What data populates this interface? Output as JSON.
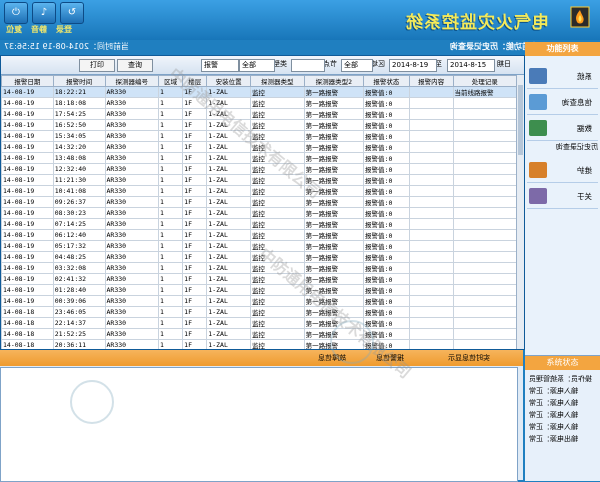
{
  "app": {
    "title": "电气火灾监控系统",
    "subtitle": "当前功能：历史记录查询",
    "status": "当前时间：2014-08-19 15:56:37"
  },
  "window_buttons": [
    {
      "label": "登录",
      "icon": "login-icon"
    },
    {
      "label": "静音",
      "icon": "mute-icon"
    },
    {
      "label": "复位",
      "icon": "reset-icon"
    }
  ],
  "toolbar": {
    "start_label": "日期",
    "start_value": "2014-8-15",
    "to_label": "至",
    "end_value": "2014-8-19",
    "area_label": "区域",
    "area_value": "全部",
    "node_label": "节点",
    "type_label": "类型",
    "type_value": "全部",
    "alarm_value": "报警",
    "query_label": "查询",
    "print_label": "打印"
  },
  "table": {
    "headers": [
      "报警日期",
      "报警时间",
      "探测器编号",
      "区域",
      "楼层",
      "安装位置",
      "探测器类型",
      "探测器类型2",
      "报警状态",
      "报警内容",
      "处理记录"
    ],
    "rows": [
      [
        "14-08-19",
        "18:22:21",
        "AR330",
        "1",
        "1F",
        "1-ZAL",
        "监控",
        "第一路报警",
        "报警值:0",
        "",
        "当前线路报警"
      ],
      [
        "14-08-19",
        "18:18:08",
        "AR330",
        "1",
        "1F",
        "1-ZAL",
        "监控",
        "第一路报警",
        "报警值:0",
        "",
        ""
      ],
      [
        "14-08-19",
        "17:54:25",
        "AR330",
        "1",
        "1F",
        "1-ZAL",
        "监控",
        "第一路报警",
        "报警值:0",
        "",
        ""
      ],
      [
        "14-08-19",
        "16:52:50",
        "AR330",
        "1",
        "1F",
        "1-ZAL",
        "监控",
        "第一路报警",
        "报警值:0",
        "",
        ""
      ],
      [
        "14-08-19",
        "15:34:05",
        "AR330",
        "1",
        "1F",
        "1-ZAL",
        "监控",
        "第一路报警",
        "报警值:0",
        "",
        ""
      ],
      [
        "14-08-19",
        "14:32:20",
        "AR330",
        "1",
        "1F",
        "1-ZAL",
        "监控",
        "第一路报警",
        "报警值:0",
        "",
        ""
      ],
      [
        "14-08-19",
        "13:48:08",
        "AR330",
        "1",
        "1F",
        "1-ZAL",
        "监控",
        "第一路报警",
        "报警值:0",
        "",
        ""
      ],
      [
        "14-08-19",
        "12:32:40",
        "AR330",
        "1",
        "1F",
        "1-ZAL",
        "监控",
        "第一路报警",
        "报警值:0",
        "",
        ""
      ],
      [
        "14-08-19",
        "11:21:30",
        "AR330",
        "1",
        "1F",
        "1-ZAL",
        "监控",
        "第一路报警",
        "报警值:0",
        "",
        ""
      ],
      [
        "14-08-19",
        "10:41:08",
        "AR330",
        "1",
        "1F",
        "1-ZAL",
        "监控",
        "第一路报警",
        "报警值:0",
        "",
        ""
      ],
      [
        "14-08-19",
        "09:26:37",
        "AR330",
        "1",
        "1F",
        "1-ZAL",
        "监控",
        "第一路报警",
        "报警值:0",
        "",
        ""
      ],
      [
        "14-08-19",
        "08:30:23",
        "AR330",
        "1",
        "1F",
        "1-ZAL",
        "监控",
        "第一路报警",
        "报警值:0",
        "",
        ""
      ],
      [
        "14-08-19",
        "07:14:25",
        "AR330",
        "1",
        "1F",
        "1-ZAL",
        "监控",
        "第一路报警",
        "报警值:0",
        "",
        ""
      ],
      [
        "14-08-19",
        "06:12:40",
        "AR330",
        "1",
        "1F",
        "1-ZAL",
        "监控",
        "第一路报警",
        "报警值:0",
        "",
        ""
      ],
      [
        "14-08-19",
        "05:17:32",
        "AR330",
        "1",
        "1F",
        "1-ZAL",
        "监控",
        "第一路报警",
        "报警值:0",
        "",
        ""
      ],
      [
        "14-08-19",
        "04:48:25",
        "AR330",
        "1",
        "1F",
        "1-ZAL",
        "监控",
        "第一路报警",
        "报警值:0",
        "",
        ""
      ],
      [
        "14-08-19",
        "03:32:08",
        "AR330",
        "1",
        "1F",
        "1-ZAL",
        "监控",
        "第一路报警",
        "报警值:0",
        "",
        ""
      ],
      [
        "14-08-19",
        "02:41:32",
        "AR330",
        "1",
        "1F",
        "1-ZAL",
        "监控",
        "第一路报警",
        "报警值:0",
        "",
        ""
      ],
      [
        "14-08-19",
        "01:28:40",
        "AR330",
        "1",
        "1F",
        "1-ZAL",
        "监控",
        "第一路报警",
        "报警值:0",
        "",
        ""
      ],
      [
        "14-08-19",
        "00:39:06",
        "AR330",
        "1",
        "1F",
        "1-ZAL",
        "监控",
        "第一路报警",
        "报警值:0",
        "",
        ""
      ],
      [
        "14-08-18",
        "23:46:05",
        "AR330",
        "1",
        "1F",
        "1-ZAL",
        "监控",
        "第一路报警",
        "报警值:0",
        "",
        ""
      ],
      [
        "14-08-18",
        "22:14:37",
        "AR330",
        "1",
        "1F",
        "1-ZAL",
        "监控",
        "第一路报警",
        "报警值:0",
        "",
        ""
      ],
      [
        "14-08-18",
        "21:52:25",
        "AR330",
        "1",
        "1F",
        "1-ZAL",
        "监控",
        "第一路报警",
        "报警值:0",
        "",
        ""
      ],
      [
        "14-08-18",
        "20:36:11",
        "AR330",
        "1",
        "1F",
        "1-ZAL",
        "监控",
        "第一路报警",
        "报警值:0",
        "",
        ""
      ],
      [
        "14-08-18",
        "19:21:27",
        "AR330",
        "1",
        "1F",
        "1-ZAL",
        "监控",
        "第一路报警",
        "报警值:0",
        "",
        ""
      ],
      [
        "14-08-18",
        "18:32:08",
        "AR330",
        "1",
        "1F",
        "1-ZAL",
        "监控",
        "第一路报警",
        "报警值:0",
        "",
        ""
      ]
    ]
  },
  "sidebar": {
    "header": "功能列表",
    "items": [
      {
        "label": "系统",
        "icon": "system-icon",
        "color": "#4a7bb8"
      },
      {
        "label": "信息查询",
        "icon": "info-icon",
        "color": "#5b9bd5"
      },
      {
        "label": "数据",
        "icon": "data-icon",
        "color": "#3d8e4e"
      },
      {
        "label": "维护",
        "icon": "maintain-icon",
        "color": "#d7802a"
      },
      {
        "label": "关于",
        "icon": "about-icon",
        "color": "#7d6aa8"
      }
    ],
    "sub_items": [
      "历史记录查询"
    ]
  },
  "bottom": {
    "tab_realtime": "实时信息显示",
    "radio_alarm": "报警信息",
    "radio_fault": "故障信息"
  },
  "right_bottom": {
    "header": "系统状态",
    "lines": [
      "操作员：系统管理员",
      "输入电源：正常",
      "输入电源：正常",
      "输入电源：正常",
      "输入电源：正常",
      "输出电源：正常"
    ]
  },
  "watermark_text": "中防通用电信技术有限公司"
}
